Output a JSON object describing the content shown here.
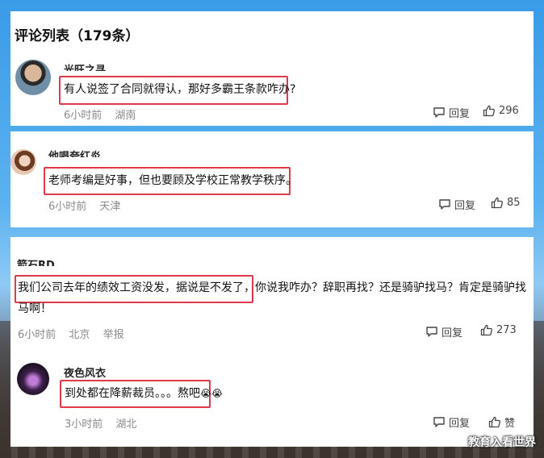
{
  "header": {
    "title": "评论列表（179条）"
  },
  "comments": [
    {
      "username": "光旺之寻",
      "text": "有人说签了合同就得认，那好多霸王条款咋办?",
      "time": "6小时前",
      "location": "湖南",
      "reply_label": "回复",
      "likes": "296"
    },
    {
      "username": "他唱夸红炎",
      "text": "老师考编是好事，但也要顾及学校正常教学秩序。",
      "time": "6小时前",
      "location": "天津",
      "reply_label": "回复",
      "likes": "85"
    },
    {
      "username": "箭石RD",
      "text_highlight": "我们公司去年的绩效工资没发，据说是不发了",
      "text_rest": "，你说我咋办？辞职再找？还是骑驴找马？肯定是骑驴找马啊！",
      "time": "6小时前",
      "location": "北京",
      "report_label": "举报",
      "reply_label": "回复",
      "likes": "273"
    }
  ],
  "sub_reply": {
    "username": "夜色风衣",
    "text": "到处都在降薪裁员。。。熬吧",
    "emojis": "😭😭",
    "time": "3小时前",
    "location": "湖北",
    "reply_label": "回复",
    "like_label": "赞"
  },
  "watermark": "教育入看世界",
  "colors": {
    "highlight_border": "#e0394a",
    "meta_text": "#8a8a8a"
  }
}
